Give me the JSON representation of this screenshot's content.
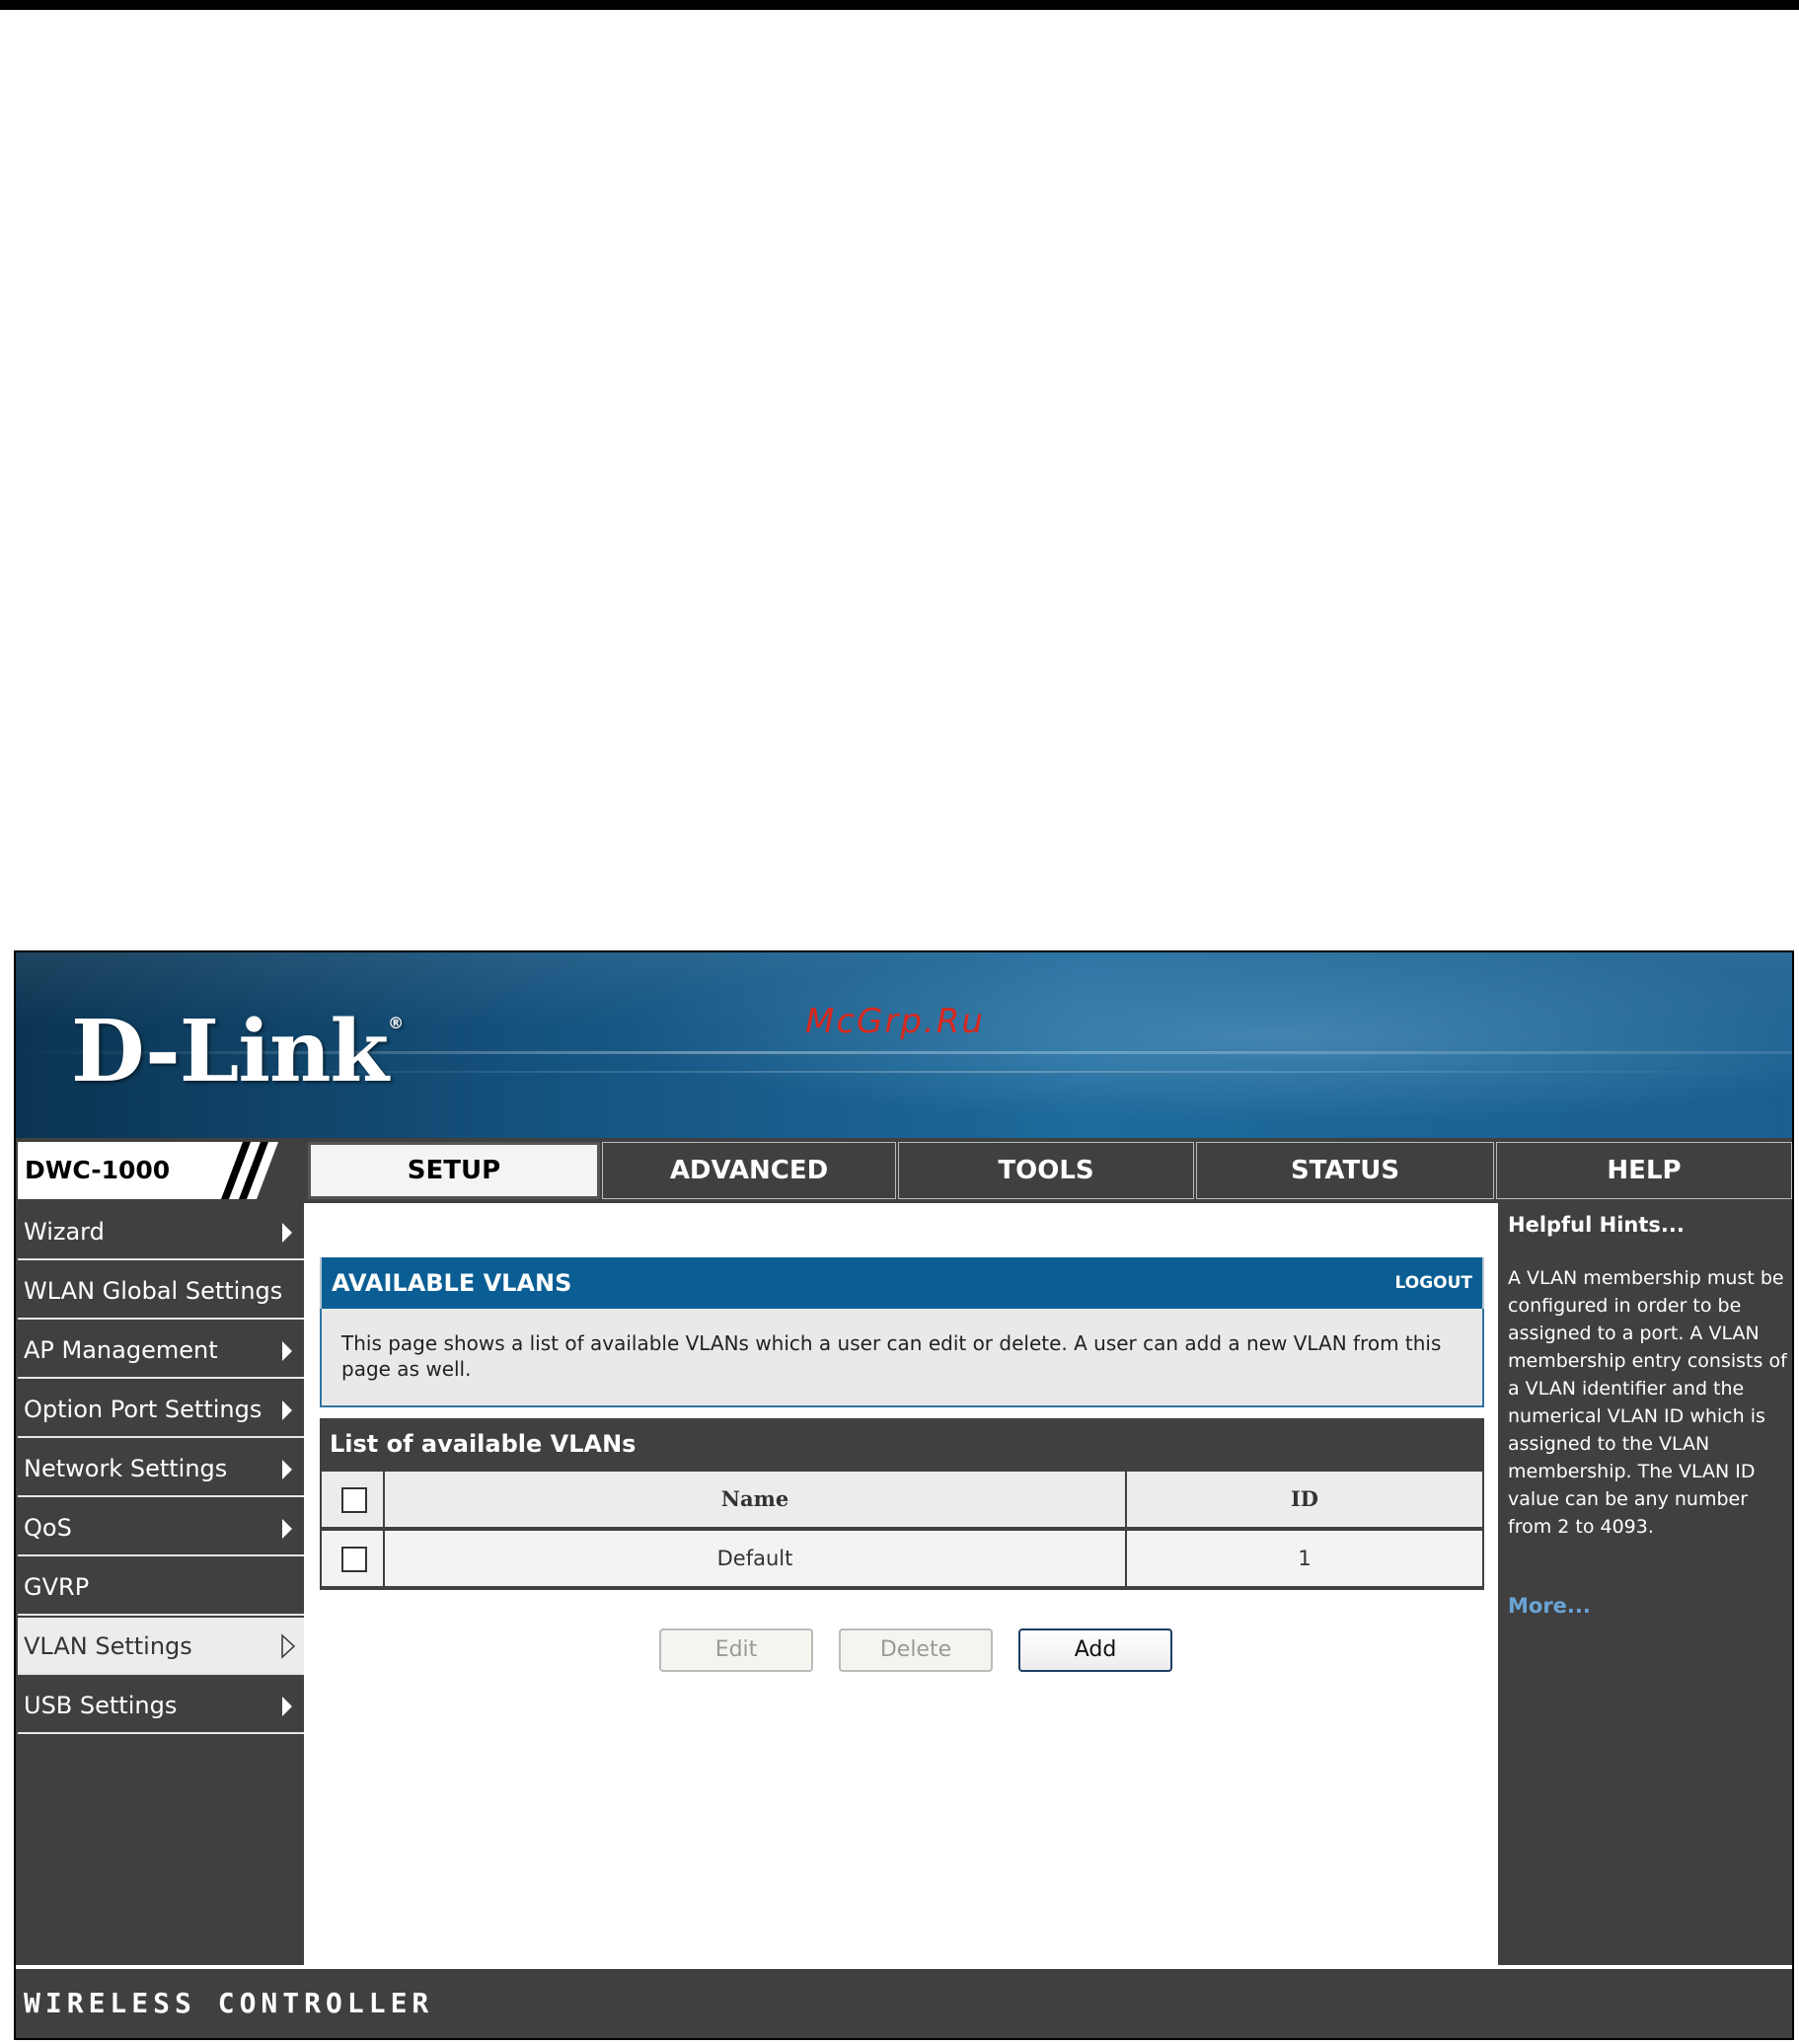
{
  "brand": {
    "logo": "D-Link",
    "registered": "®",
    "watermark": "McGrp.Ru",
    "model": "DWC-1000"
  },
  "tabs": [
    {
      "label": "SETUP",
      "active": true
    },
    {
      "label": "ADVANCED",
      "active": false
    },
    {
      "label": "TOOLS",
      "active": false
    },
    {
      "label": "STATUS",
      "active": false
    },
    {
      "label": "HELP",
      "active": false
    }
  ],
  "sidebar": {
    "items": [
      {
        "label": "Wizard",
        "active": false
      },
      {
        "label": "WLAN Global Settings",
        "active": false
      },
      {
        "label": "AP Management",
        "active": false
      },
      {
        "label": "Option Port Settings",
        "active": false
      },
      {
        "label": "Network Settings",
        "active": false
      },
      {
        "label": "QoS",
        "active": false
      },
      {
        "label": "GVRP",
        "active": false
      },
      {
        "label": "VLAN Settings",
        "active": true
      },
      {
        "label": "USB Settings",
        "active": false
      }
    ]
  },
  "main": {
    "title": "AVAILABLE VLANS",
    "logout": "LOGOUT",
    "description": "This page shows a list of available VLANs which a user can edit or delete. A user can add a new VLAN from this page as well.",
    "list_title": "List of available VLANs",
    "table": {
      "headers": [
        "Name",
        "ID"
      ],
      "rows": [
        {
          "name": "Default",
          "id": "1"
        }
      ]
    },
    "buttons": {
      "edit": "Edit",
      "delete": "Delete",
      "add": "Add"
    }
  },
  "help": {
    "title": "Helpful Hints...",
    "text": "A VLAN membership must be configured in order to be assigned to a port. A VLAN membership entry consists of a VLAN identifier and the numerical VLAN ID which is assigned to the VLAN membership. The VLAN ID value can be any number from 2 to 4093.",
    "more": "More..."
  },
  "footer": {
    "text": "WIRELESS CONTROLLER"
  },
  "colors": {
    "banner": "#15537f",
    "panel_header": "#0a5e94",
    "dark_gray": "#404040",
    "more_link": "#6aa4d6",
    "watermark": "#d8281e"
  }
}
